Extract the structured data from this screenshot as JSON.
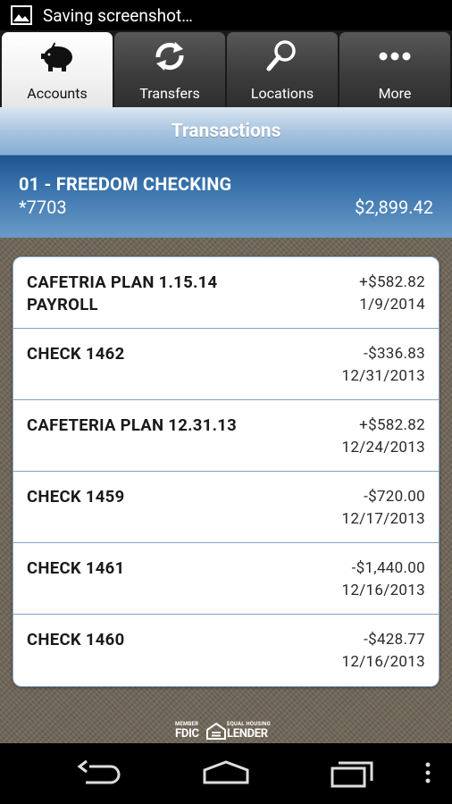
{
  "status_bar": {
    "text": "Saving screenshot…"
  },
  "tabs": [
    {
      "label": "Accounts",
      "icon": "piggy-bank-icon",
      "active": true
    },
    {
      "label": "Transfers",
      "icon": "transfer-arrows-icon",
      "active": false
    },
    {
      "label": "Locations",
      "icon": "magnifier-icon",
      "active": false
    },
    {
      "label": "More",
      "icon": "more-dots-icon",
      "active": false
    }
  ],
  "page": {
    "title": "Transactions"
  },
  "account": {
    "name": "01 - FREEDOM CHECKING",
    "number": "*7703",
    "balance": "$2,899.42"
  },
  "transactions": [
    {
      "description": "CAFETRIA PLAN 1.15.14 PAYROLL",
      "amount": "+$582.82",
      "date": "1/9/2014"
    },
    {
      "description": "CHECK 1462",
      "amount": "-$336.83",
      "date": "12/31/2013"
    },
    {
      "description": "CAFETERIA PLAN 12.31.13",
      "amount": "+$582.82",
      "date": "12/24/2013"
    },
    {
      "description": "CHECK 1459",
      "amount": "-$720.00",
      "date": "12/17/2013"
    },
    {
      "description": "CHECK 1461",
      "amount": "-$1,440.00",
      "date": "12/16/2013"
    },
    {
      "description": "CHECK 1460",
      "amount": "-$428.77",
      "date": "12/16/2013"
    }
  ],
  "footer": {
    "member": "MEMBER",
    "fdic": "FDIC",
    "equal_housing": "EQUAL HOUSING",
    "lender": "LENDER"
  },
  "colors": {
    "accent_blue": "#3a74ad",
    "title_bar": "#a9c5df",
    "background_texture": "#6f6557"
  },
  "nav": {
    "icons": [
      "back-icon",
      "home-icon",
      "recent-apps-icon",
      "menu-icon"
    ]
  }
}
